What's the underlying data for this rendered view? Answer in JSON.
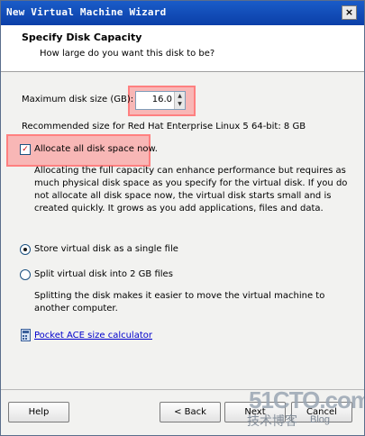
{
  "window": {
    "title": "New Virtual Machine Wizard",
    "close_glyph": "×"
  },
  "header": {
    "title": "Specify Disk Capacity",
    "subtitle": "How large do you want this disk to be?"
  },
  "disk": {
    "size_label": "Maximum disk size (GB):",
    "size_value": "16.0",
    "recommended": "Recommended size for Red Hat Enterprise Linux 5 64-bit: 8 GB"
  },
  "allocate": {
    "label": "Allocate all disk space now.",
    "checked": true,
    "description": "Allocating the full capacity can enhance performance but requires as much physical disk space as you specify for the virtual disk. If you do not allocate all disk space now, the virtual disk starts small and is created quickly. It grows as you add applications, files and data."
  },
  "options": {
    "single_file": {
      "label": "Store virtual disk as a single file",
      "selected": true
    },
    "split": {
      "label": "Split virtual disk into 2 GB files",
      "selected": false,
      "description": "Splitting the disk makes it easier to move the virtual machine to another computer."
    }
  },
  "link": {
    "label": "Pocket ACE size calculator"
  },
  "buttons": {
    "help": "Help",
    "back": "< Back",
    "next": "Next",
    "cancel": "Cancel"
  },
  "watermark": {
    "main": "51CTO.com",
    "sub": "技术博客",
    "blog": "Blog"
  },
  "colors": {
    "titlebar": "#0b3fa8",
    "highlight": "#ff6e6e",
    "link": "#0000cc"
  }
}
